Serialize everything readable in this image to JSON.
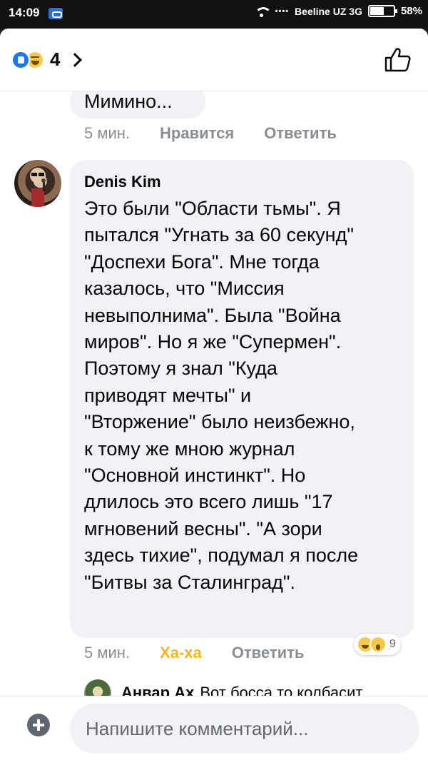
{
  "status_bar": {
    "time": "14:09",
    "dots": "••••",
    "carrier": "Beeline UZ 3G",
    "battery": "58%"
  },
  "header": {
    "reaction_count": "4",
    "reaction_icons": [
      "like-icon",
      "haha-icon"
    ],
    "right_icon": "thumbs-up-outline-icon"
  },
  "comments": [
    {
      "text": "Мимино...",
      "time": "5 мин.",
      "like_label": "Нравится",
      "reply_label": "Ответить"
    },
    {
      "author": "Denis Kim",
      "lines": [
        "Это были \"Области тьмы\". Я",
        "пытался \"Угнать за 60 секунд\"",
        "\"Доспехи Бога\". Мне тогда",
        "казалось, что \"Миссия",
        "невыполнима\". Была \"Война",
        "миров\". Но я же \"Супермен\".",
        "Поэтому я знал \"Куда",
        "приводят мечты\" и",
        "\"Вторжение\"  было неизбежно,",
        "к тому же мною журнал",
        "\"Основной инстинкт\". Но",
        "длилось это всего лишь \"17",
        "мгновений весны\". \"А зори",
        "здесь тихие\", подумал я после",
        "\"Битвы за Сталинград\"."
      ],
      "time": "5 мин.",
      "reaction_label": "Ха-ха",
      "reply_label": "Ответить",
      "reaction_count": "9",
      "reaction_icons": [
        "haha-icon",
        "wow-icon"
      ],
      "reply": {
        "author": "Анвар Ах",
        "text": "Вот босса то колбасит..."
      }
    }
  ],
  "composer": {
    "placeholder": "Напишите комментарий..."
  },
  "colors": {
    "accent": "#1877f2",
    "bubble": "#f0f2f5",
    "haha": "#f2b71e",
    "meta": "#8a8d91"
  }
}
